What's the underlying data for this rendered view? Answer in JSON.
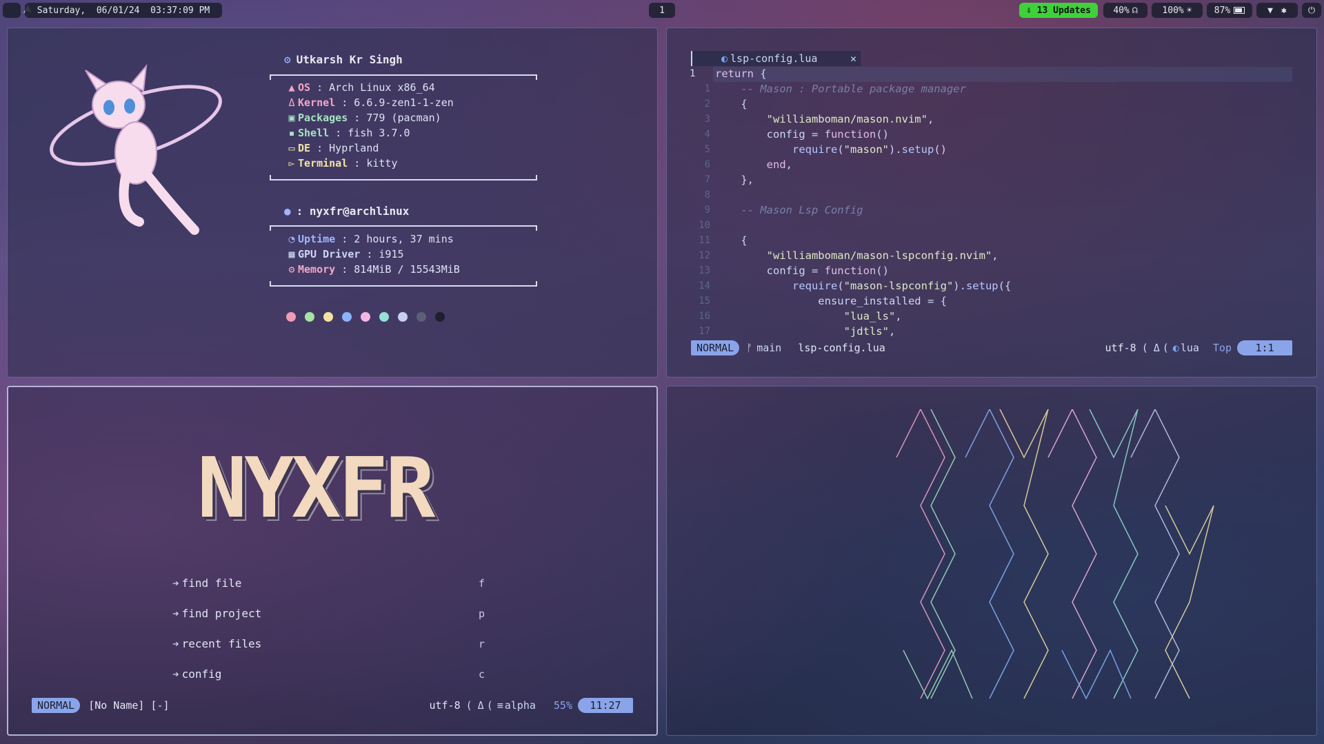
{
  "topbar": {
    "launcher_icon": "arch-logo-icon",
    "datetime": "Saturday,  06/01/24  03:37:09 PM",
    "workspace": "1",
    "updates": "⇩ 13 Updates",
    "volume": "40%",
    "brightness": "100%",
    "battery": "87%"
  },
  "fetch": {
    "username": "Utkarsh Kr Singh",
    "system": [
      {
        "icon": "arch-icon",
        "key": "OS",
        "value": " : Arch Linux x86_64",
        "color": "#f4a6c8"
      },
      {
        "icon": "linux-icon",
        "key": "Kernel",
        "value": " : 6.6.9-zen1-1-zen",
        "color": "#f4a6c8"
      },
      {
        "icon": "package-icon",
        "key": "Packages",
        "value": " : 779 (pacman)",
        "color": "#a6e3c1"
      },
      {
        "icon": "shell-icon",
        "key": "Shell",
        "value": " : fish 3.7.0",
        "color": "#a6e3c1"
      },
      {
        "icon": "monitor-icon",
        "key": "DE",
        "value": " : Hyprland",
        "color": "#f2e3a2"
      },
      {
        "icon": "terminal-icon",
        "key": "Terminal",
        "value": " : kitty",
        "color": "#f2e3a2"
      }
    ],
    "host": ": nyxfr@archlinux",
    "hardware": [
      {
        "icon": "uptime-icon",
        "key": "Uptime",
        "value": " : 2 hours, 37 mins",
        "color": "#9fb4ff"
      },
      {
        "icon": "gpu-icon",
        "key": "GPU Driver",
        "value": " : i915",
        "color": "#cdd6f4"
      },
      {
        "icon": "memory-icon",
        "key": "Memory",
        "value": " : 814MiB / 15543MiB",
        "color": "#f4a6c8"
      }
    ],
    "palette": [
      "#f19ab6",
      "#a6e3a1",
      "#f2e3a2",
      "#89b4fa",
      "#f5b5e2",
      "#94e2d5",
      "#c7cdf5",
      "#5b5f78",
      "#1e1e2e"
    ]
  },
  "editor": {
    "tab": "lsp-config.lua",
    "code": [
      {
        "n": "1",
        "t": [
          {
            "c": "kw",
            "s": "return"
          },
          {
            "c": "",
            "s": " {"
          }
        ]
      },
      {
        "n": "1",
        "t": [
          {
            "c": "cmt",
            "s": "    -- Mason : Portable package manager"
          }
        ]
      },
      {
        "n": "2",
        "t": [
          {
            "c": "",
            "s": "    {"
          }
        ]
      },
      {
        "n": "3",
        "t": [
          {
            "c": "",
            "s": "        "
          },
          {
            "c": "str",
            "s": "\"williamboman/mason.nvim\""
          },
          {
            "c": "",
            "s": ","
          }
        ]
      },
      {
        "n": "4",
        "t": [
          {
            "c": "",
            "s": "        config = "
          },
          {
            "c": "kw",
            "s": "function"
          },
          {
            "c": "",
            "s": "()"
          }
        ]
      },
      {
        "n": "5",
        "t": [
          {
            "c": "",
            "s": "            "
          },
          {
            "c": "fn",
            "s": "require"
          },
          {
            "c": "",
            "s": "("
          },
          {
            "c": "str",
            "s": "\"mason\""
          },
          {
            "c": "",
            "s": ")."
          },
          {
            "c": "fn",
            "s": "setup"
          },
          {
            "c": "",
            "s": "()"
          }
        ]
      },
      {
        "n": "6",
        "t": [
          {
            "c": "",
            "s": "        "
          },
          {
            "c": "kw",
            "s": "end"
          },
          {
            "c": "",
            "s": ","
          }
        ]
      },
      {
        "n": "7",
        "t": [
          {
            "c": "",
            "s": "    },"
          }
        ]
      },
      {
        "n": "8",
        "t": [
          {
            "c": "",
            "s": ""
          }
        ]
      },
      {
        "n": "9",
        "t": [
          {
            "c": "cmt",
            "s": "    -- Mason Lsp Config"
          }
        ]
      },
      {
        "n": "10",
        "t": [
          {
            "c": "",
            "s": ""
          }
        ]
      },
      {
        "n": "11",
        "t": [
          {
            "c": "",
            "s": "    {"
          }
        ]
      },
      {
        "n": "12",
        "t": [
          {
            "c": "",
            "s": "        "
          },
          {
            "c": "str",
            "s": "\"williamboman/mason-lspconfig.nvim\""
          },
          {
            "c": "",
            "s": ","
          }
        ]
      },
      {
        "n": "13",
        "t": [
          {
            "c": "",
            "s": "        config = "
          },
          {
            "c": "kw",
            "s": "function"
          },
          {
            "c": "",
            "s": "()"
          }
        ]
      },
      {
        "n": "14",
        "t": [
          {
            "c": "",
            "s": "            "
          },
          {
            "c": "fn",
            "s": "require"
          },
          {
            "c": "",
            "s": "("
          },
          {
            "c": "str",
            "s": "\"mason-lspconfig\""
          },
          {
            "c": "",
            "s": ")."
          },
          {
            "c": "fn",
            "s": "setup"
          },
          {
            "c": "",
            "s": "({"
          }
        ]
      },
      {
        "n": "15",
        "t": [
          {
            "c": "",
            "s": "                ensure_installed = {"
          }
        ]
      },
      {
        "n": "16",
        "t": [
          {
            "c": "",
            "s": "                    "
          },
          {
            "c": "str",
            "s": "\"lua_ls\""
          },
          {
            "c": "",
            "s": ","
          }
        ]
      },
      {
        "n": "17",
        "t": [
          {
            "c": "",
            "s": "                    "
          },
          {
            "c": "str",
            "s": "\"jdtls\""
          },
          {
            "c": "",
            "s": ","
          }
        ]
      }
    ],
    "status": {
      "mode": "NORMAL",
      "branch": "main",
      "file": "lsp-config.lua",
      "encoding": "utf-8",
      "filetype": "lua",
      "scroll": "Top",
      "position": "1:1"
    }
  },
  "dashboard": {
    "banner": "NYXFR",
    "items": [
      {
        "label": "find file",
        "key": "f"
      },
      {
        "label": "find project",
        "key": "p"
      },
      {
        "label": "recent files",
        "key": "r"
      },
      {
        "label": "config",
        "key": "c"
      }
    ],
    "status": {
      "mode": "NORMAL",
      "buffer": "[No Name] [-]",
      "encoding": "utf-8",
      "filetype": "alpha",
      "percent": "55%",
      "position": "11:27"
    }
  }
}
